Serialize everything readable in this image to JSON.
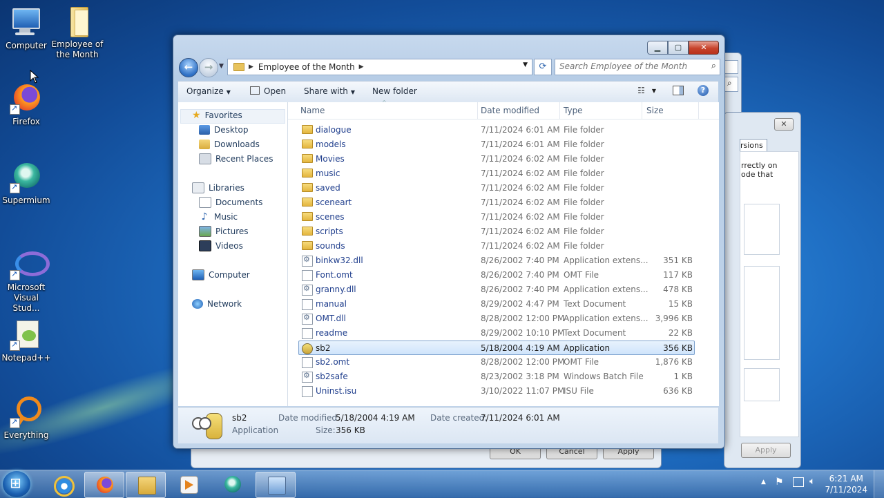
{
  "desktop": {
    "icons": [
      {
        "label": "Computer"
      },
      {
        "label": "Employee of the Month"
      },
      {
        "label": "Firefox"
      },
      {
        "label": "Supermium"
      },
      {
        "label": "Microsoft Visual Stud..."
      },
      {
        "label": "Notepad++"
      },
      {
        "label": "Everything"
      }
    ]
  },
  "background_dialog": {
    "tab_fragment": "rsions",
    "text_line1": "rrectly on",
    "text_line2": "ode that",
    "ok": "OK",
    "cancel": "Cancel",
    "apply": "Apply",
    "apply2": "Apply"
  },
  "explorer": {
    "address": {
      "location": "Employee of the Month"
    },
    "search": {
      "placeholder": "Search Employee of the Month"
    },
    "toolbar": {
      "organize": "Organize",
      "open": "Open",
      "share_with": "Share with",
      "new_folder": "New folder"
    },
    "nav": {
      "favorites": "Favorites",
      "desktop": "Desktop",
      "downloads": "Downloads",
      "recent_places": "Recent Places",
      "libraries": "Libraries",
      "documents": "Documents",
      "music": "Music",
      "pictures": "Pictures",
      "videos": "Videos",
      "computer": "Computer",
      "network": "Network"
    },
    "columns": {
      "name": "Name",
      "date": "Date modified",
      "type": "Type",
      "size": "Size"
    },
    "files": [
      {
        "name": "dialogue",
        "date": "7/11/2024 6:01 AM",
        "type": "File folder",
        "size": "",
        "icon": "folder"
      },
      {
        "name": "models",
        "date": "7/11/2024 6:01 AM",
        "type": "File folder",
        "size": "",
        "icon": "folder"
      },
      {
        "name": "Movies",
        "date": "7/11/2024 6:02 AM",
        "type": "File folder",
        "size": "",
        "icon": "folder"
      },
      {
        "name": "music",
        "date": "7/11/2024 6:02 AM",
        "type": "File folder",
        "size": "",
        "icon": "folder"
      },
      {
        "name": "saved",
        "date": "7/11/2024 6:02 AM",
        "type": "File folder",
        "size": "",
        "icon": "folder"
      },
      {
        "name": "sceneart",
        "date": "7/11/2024 6:02 AM",
        "type": "File folder",
        "size": "",
        "icon": "folder"
      },
      {
        "name": "scenes",
        "date": "7/11/2024 6:02 AM",
        "type": "File folder",
        "size": "",
        "icon": "folder"
      },
      {
        "name": "scripts",
        "date": "7/11/2024 6:02 AM",
        "type": "File folder",
        "size": "",
        "icon": "folder"
      },
      {
        "name": "sounds",
        "date": "7/11/2024 6:02 AM",
        "type": "File folder",
        "size": "",
        "icon": "folder"
      },
      {
        "name": "binkw32.dll",
        "date": "8/26/2002 7:40 PM",
        "type": "Application extens...",
        "size": "351 KB",
        "icon": "dll"
      },
      {
        "name": "Font.omt",
        "date": "8/26/2002 7:40 PM",
        "type": "OMT File",
        "size": "117 KB",
        "icon": "doc"
      },
      {
        "name": "granny.dll",
        "date": "8/26/2002 7:40 PM",
        "type": "Application extens...",
        "size": "478 KB",
        "icon": "dll"
      },
      {
        "name": "manual",
        "date": "8/29/2002 4:47 PM",
        "type": "Text Document",
        "size": "15 KB",
        "icon": "doc"
      },
      {
        "name": "OMT.dll",
        "date": "8/28/2002 12:00 PM",
        "type": "Application extens...",
        "size": "3,996 KB",
        "icon": "dll"
      },
      {
        "name": "readme",
        "date": "8/29/2002 10:10 PM",
        "type": "Text Document",
        "size": "22 KB",
        "icon": "doc"
      },
      {
        "name": "sb2",
        "date": "5/18/2004 4:19 AM",
        "type": "Application",
        "size": "356 KB",
        "icon": "app",
        "selected": true
      },
      {
        "name": "sb2.omt",
        "date": "8/28/2002 12:00 PM",
        "type": "OMT File",
        "size": "1,876 KB",
        "icon": "doc"
      },
      {
        "name": "sb2safe",
        "date": "8/23/2002 3:18 PM",
        "type": "Windows Batch File",
        "size": "1 KB",
        "icon": "dll"
      },
      {
        "name": "Uninst.isu",
        "date": "3/10/2022 11:07 PM",
        "type": "ISU File",
        "size": "636 KB",
        "icon": "doc"
      }
    ],
    "details": {
      "name": "sb2",
      "kind": "Application",
      "date_modified_label": "Date modified:",
      "date_modified": "5/18/2004 4:19 AM",
      "date_created_label": "Date created:",
      "date_created": "7/11/2024 6:01 AM",
      "size_label": "Size:",
      "size": "356 KB"
    }
  },
  "taskbar": {
    "time": "6:21 AM",
    "date": "7/11/2024"
  }
}
